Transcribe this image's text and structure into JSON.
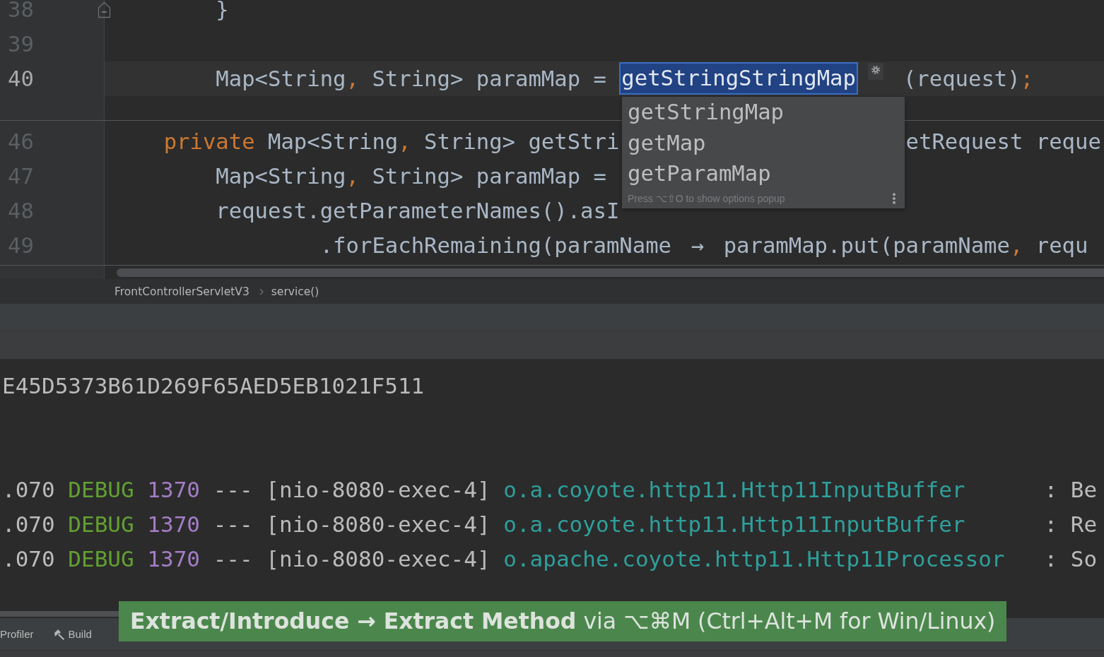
{
  "editor": {
    "top_lines": [
      {
        "number": "38",
        "kind": "statement",
        "current": false,
        "fold_marker": true,
        "parts": [
          {
            "kind": "code",
            "tokens": [
              {
                "text": "}",
                "kind": "plain"
              }
            ]
          }
        ]
      },
      {
        "number": "39",
        "kind": "blank",
        "current": false,
        "fold_marker": false
      },
      {
        "number": "40",
        "kind": "statement",
        "current": true,
        "fold_marker": false,
        "parts": [
          {
            "kind": "code",
            "tokens": [
              {
                "text": "Map<String",
                "kind": "plain"
              },
              {
                "text": ",",
                "kind": "punct"
              },
              {
                "text": " String> paramMap =",
                "kind": "plain"
              }
            ]
          },
          {
            "kind": "rename_field",
            "value": "getStringStringMap"
          },
          {
            "kind": "code",
            "tokens": [
              {
                "text": "(request)",
                "kind": "plain"
              },
              {
                "text": ";",
                "kind": "punct"
              }
            ]
          }
        ]
      }
    ],
    "rename_popup": {
      "items": [
        {
          "label": "getStringMap",
          "selected": false
        },
        {
          "label": "getMap",
          "selected": false
        },
        {
          "label": "getParamMap",
          "selected": false
        }
      ],
      "hint": "Press ⌥⇧O to show options popup"
    },
    "bottom_lines": [
      {
        "number": "46",
        "kind": "member",
        "current": false,
        "fold_marker": false,
        "parts": [
          {
            "kind": "code",
            "tokens": [
              {
                "text": "private",
                "kind": "keyword"
              },
              {
                "text": " Map<String",
                "kind": "plain"
              },
              {
                "text": ",",
                "kind": "punct"
              },
              {
                "text": " String> getStri",
                "kind": "plain"
              }
            ]
          },
          {
            "kind": "code",
            "beyond_popup": true,
            "tokens": [
              {
                "text": "etRequest reque",
                "kind": "plain"
              }
            ]
          }
        ]
      },
      {
        "number": "47",
        "kind": "statement",
        "current": false,
        "fold_marker": false,
        "parts": [
          {
            "kind": "code",
            "tokens": [
              {
                "text": "Map<String",
                "kind": "plain"
              },
              {
                "text": ",",
                "kind": "punct"
              },
              {
                "text": " String> paramMap =",
                "kind": "plain"
              }
            ]
          }
        ]
      },
      {
        "number": "48",
        "kind": "statement",
        "current": false,
        "fold_marker": false,
        "parts": [
          {
            "kind": "code",
            "tokens": [
              {
                "text": "request.getParameterNames().asI",
                "kind": "plain"
              }
            ]
          }
        ]
      },
      {
        "number": "49",
        "kind": "continuation",
        "current": false,
        "fold_marker": false,
        "parts": [
          {
            "kind": "code",
            "tokens": [
              {
                "text": ".forEachRemaining(paramName ",
                "kind": "plain"
              },
              {
                "text": "→",
                "kind": "ligature"
              },
              {
                "text": " paramMap.put(paramName",
                "kind": "plain"
              },
              {
                "text": ",",
                "kind": "punct"
              },
              {
                "text": " requ",
                "kind": "plain"
              }
            ]
          }
        ]
      }
    ]
  },
  "breadcrumbs": [
    "FrontControllerServletV3",
    "service()"
  ],
  "console": {
    "lines": [
      {
        "text": "E45D5373B61D269F65AED5EB1021F511"
      }
    ],
    "log_entries": [
      {
        "time": ".070",
        "level": "DEBUG",
        "pid": "1370",
        "separator": "---",
        "thread": "[nio-8080-exec-4]",
        "logger": "o.a.coyote.http11.Http11InputBuffer",
        "message": ": Be"
      },
      {
        "time": ".070",
        "level": "DEBUG",
        "pid": "1370",
        "separator": "---",
        "thread": "[nio-8080-exec-4]",
        "logger": "o.a.coyote.http11.Http11InputBuffer",
        "message": ": Re"
      },
      {
        "time": ".070",
        "level": "DEBUG",
        "pid": "1370",
        "separator": "---",
        "thread": "[nio-8080-exec-4]",
        "logger": "o.apache.coyote.http11.Http11Processor",
        "message": ": So"
      }
    ]
  },
  "tool_window_bar": {
    "buttons": [
      {
        "label": "Profiler",
        "kind": "text"
      },
      {
        "label": "Build",
        "kind": "build"
      }
    ]
  },
  "action_banner": {
    "text": "**Extract/Introduce → Extract Method** via ⌥⌘M (Ctrl+Alt+M for Win/Linux)"
  }
}
